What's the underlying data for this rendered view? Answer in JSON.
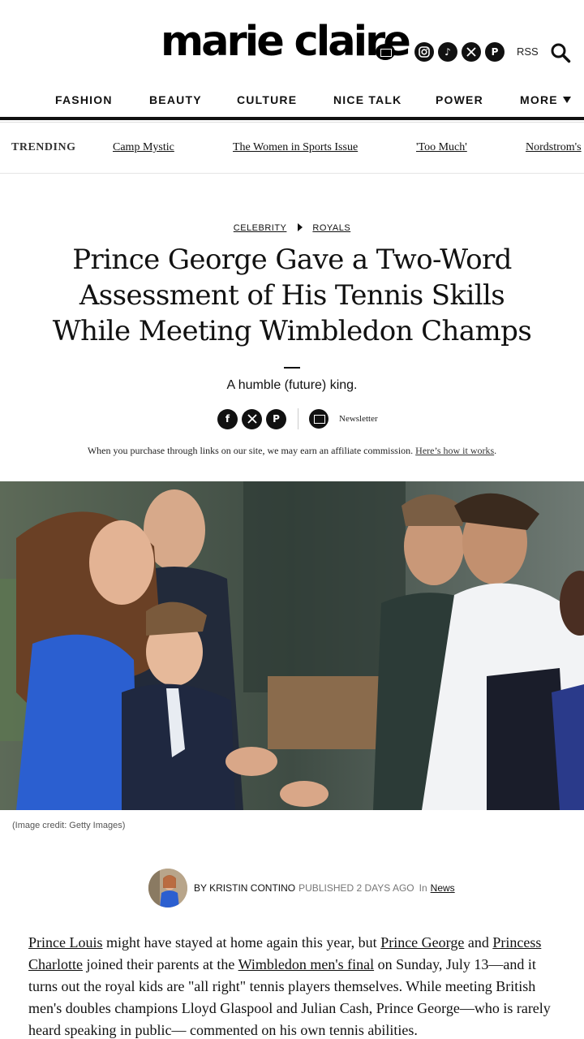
{
  "header": {
    "logo": "marie claire",
    "social": [
      "instagram-icon",
      "tiktok-icon",
      "x-icon",
      "pinterest-icon"
    ],
    "rss": "RSS"
  },
  "nav": {
    "items": [
      "FASHION",
      "BEAUTY",
      "CULTURE",
      "NICE TALK",
      "POWER"
    ],
    "more": "MORE"
  },
  "trending": {
    "label": "TRENDING",
    "links": [
      "Camp Mystic",
      "The Women in Sports Issue",
      "'Too Much'",
      "Nordstrom's"
    ]
  },
  "article": {
    "crumb1": "CELEBRITY",
    "crumb2": "ROYALS",
    "title": "Prince George Gave a Two-Word Assessment of His Tennis Skills While Meeting Wimbledon Champs",
    "strap": "A humble (future) king.",
    "share_icons": [
      "facebook-icon",
      "x-icon",
      "pinterest-icon"
    ],
    "newsletter": "Newsletter",
    "affiliate": "When you purchase through links on our site, we may earn an affiliate commission.",
    "affiliate_link": "Here’s how it works",
    "affiliate_end": ".",
    "image_credit": "(Image credit: Getty Images)",
    "byline": {
      "by": "BY KRISTIN CONTINO",
      "published": "PUBLISHED 2 DAYS AGO",
      "in": "In",
      "section": "News"
    },
    "body": {
      "l1": "Prince Louis",
      "t1": " might have stayed at home again this year, but ",
      "l2": "Prince George",
      "t2": " and ",
      "l3": "Princess Charlotte",
      "t3": " joined their parents at the ",
      "l4": "Wimbledon men's final",
      "t4": " on Sunday, July 13—and it turns out the royal kids are \"all right\" tennis players themselves. While meeting British men's doubles champions Lloyd Glaspool and Julian Cash, Prince George—who is rarely heard speaking in public— commented on his own tennis abilities."
    }
  },
  "colors": {
    "text": "#111111",
    "muted": "#777777",
    "dress_blue": "#2b5fd0"
  }
}
